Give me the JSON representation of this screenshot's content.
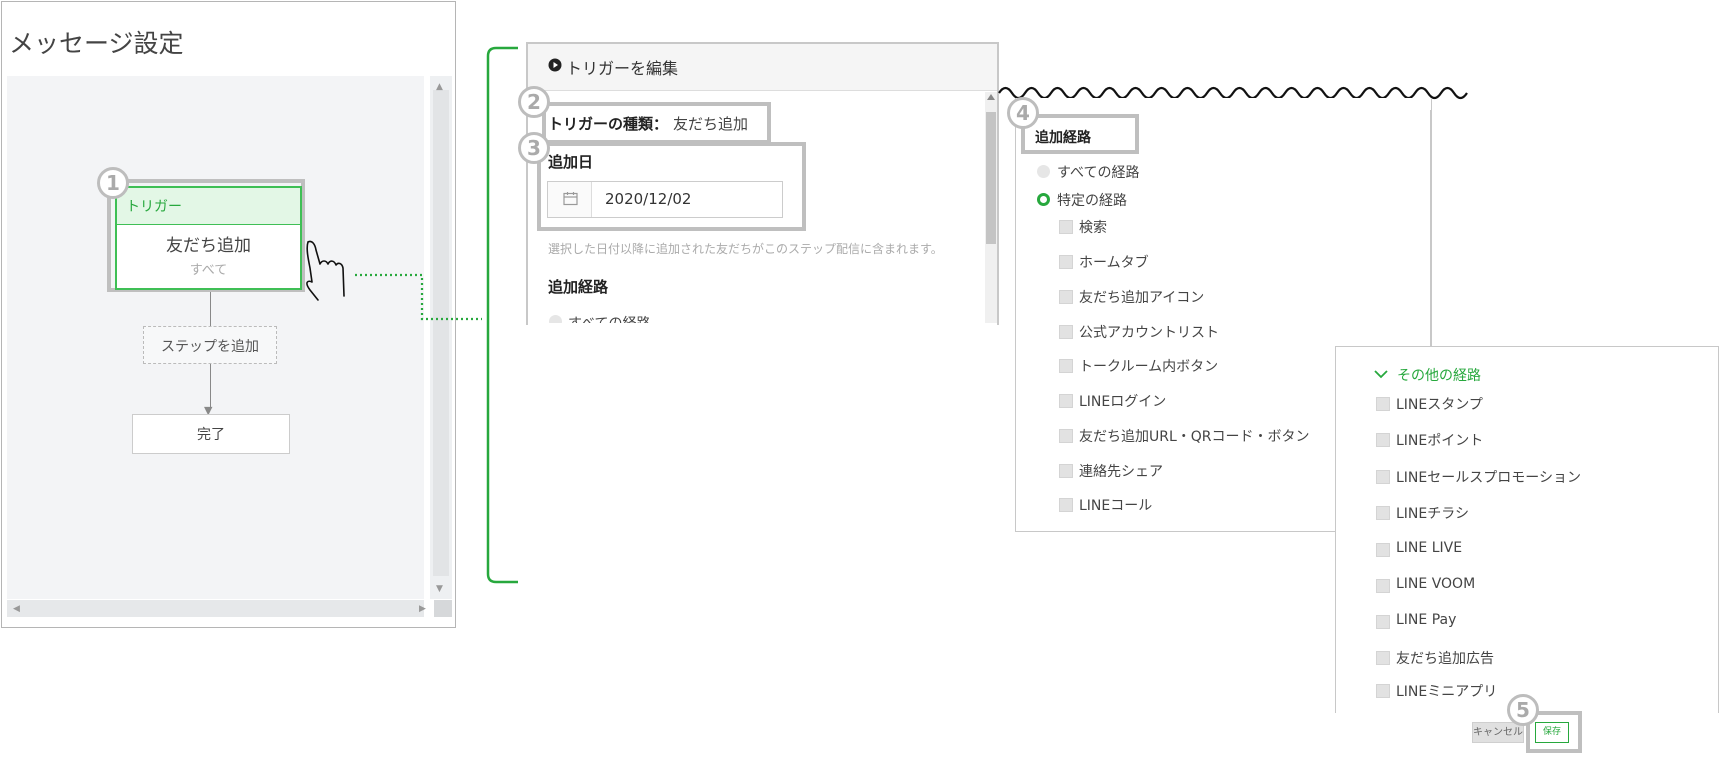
{
  "left": {
    "title": "メッセージ設定",
    "trigger_node": {
      "header": "トリガー",
      "type": "友だち追加",
      "sub": "すべて"
    },
    "add_step": "ステップを追加",
    "complete": "完了"
  },
  "middle": {
    "title": "トリガーを編集",
    "trigger_type_label": "トリガーの種類：",
    "trigger_type_value": "友だち追加",
    "date_label": "追加日",
    "date_value": "2020/12/02",
    "date_help": "選択した日付以降に追加された友だちがこのステップ配信に含まれます。",
    "route_label": "追加経路",
    "route_all_partial": "すべての経路"
  },
  "routes": {
    "label": "追加経路",
    "radios": [
      {
        "label": "すべての経路",
        "selected": false
      },
      {
        "label": "特定の経路",
        "selected": true
      }
    ],
    "checkboxes": [
      "検索",
      "ホームタブ",
      "友だち追加アイコン",
      "公式アカウントリスト",
      "トークルーム内ボタン",
      "LINEログイン",
      "友だち追加URL・QRコード・ボタン",
      "連絡先シェア",
      "LINEコール"
    ]
  },
  "other_routes": {
    "label": "その他の経路",
    "checkboxes": [
      "LINEスタンプ",
      "LINEポイント",
      "LINEセールスプロモーション",
      "LINEチラシ",
      "LINE LIVE",
      "LINE VOOM",
      "LINE Pay",
      "友だち追加広告",
      "LINEミニアプリ"
    ]
  },
  "buttons": {
    "cancel": "キャンセル",
    "save": "保存"
  },
  "badges": [
    "1",
    "2",
    "3",
    "4",
    "5"
  ],
  "colors": {
    "accent": "#27a83d",
    "frame": "#bfbfbf",
    "node_bg": "#e3f7e6"
  }
}
